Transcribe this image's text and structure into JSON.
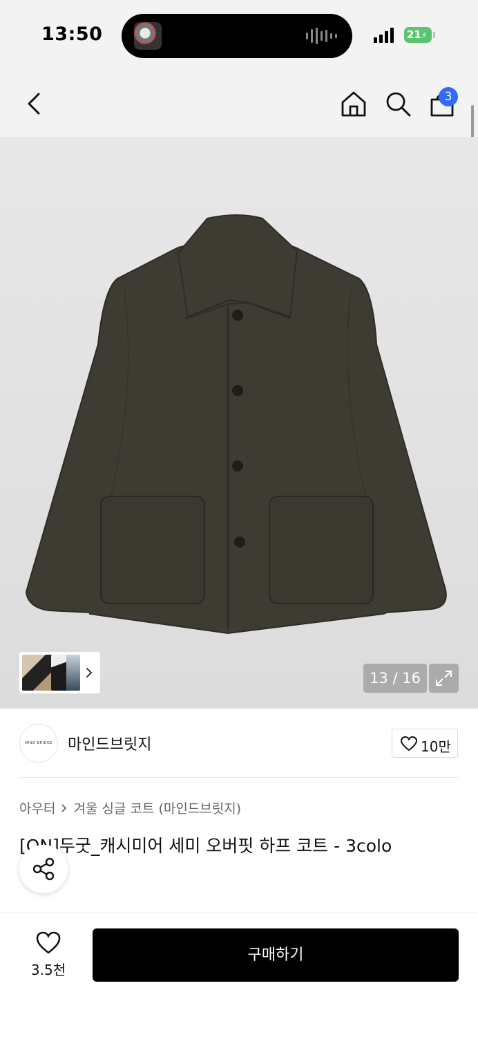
{
  "status_bar": {
    "time": "13:50",
    "battery": "21"
  },
  "header": {
    "cart_count": "3"
  },
  "gallery": {
    "counter": "13 / 16"
  },
  "brand": {
    "logo_text": "MIND BRIDGE",
    "name": "마인드브릿지",
    "likes": "10만"
  },
  "breadcrumb": {
    "category": "아우터",
    "subcategory": "겨울 싱글 코트 (마인드브릿지)"
  },
  "product": {
    "title": "[ON]두굿_캐시미어 세미 오버핏 하프 코트 - 3colo"
  },
  "bottom_bar": {
    "wish_count": "3.5천",
    "buy_label": "구매하기"
  },
  "colors": {
    "cart_badge": "#2f6df6",
    "battery": "#5ac56e",
    "buy_button": "#000000",
    "coat": "#3e3b32"
  }
}
